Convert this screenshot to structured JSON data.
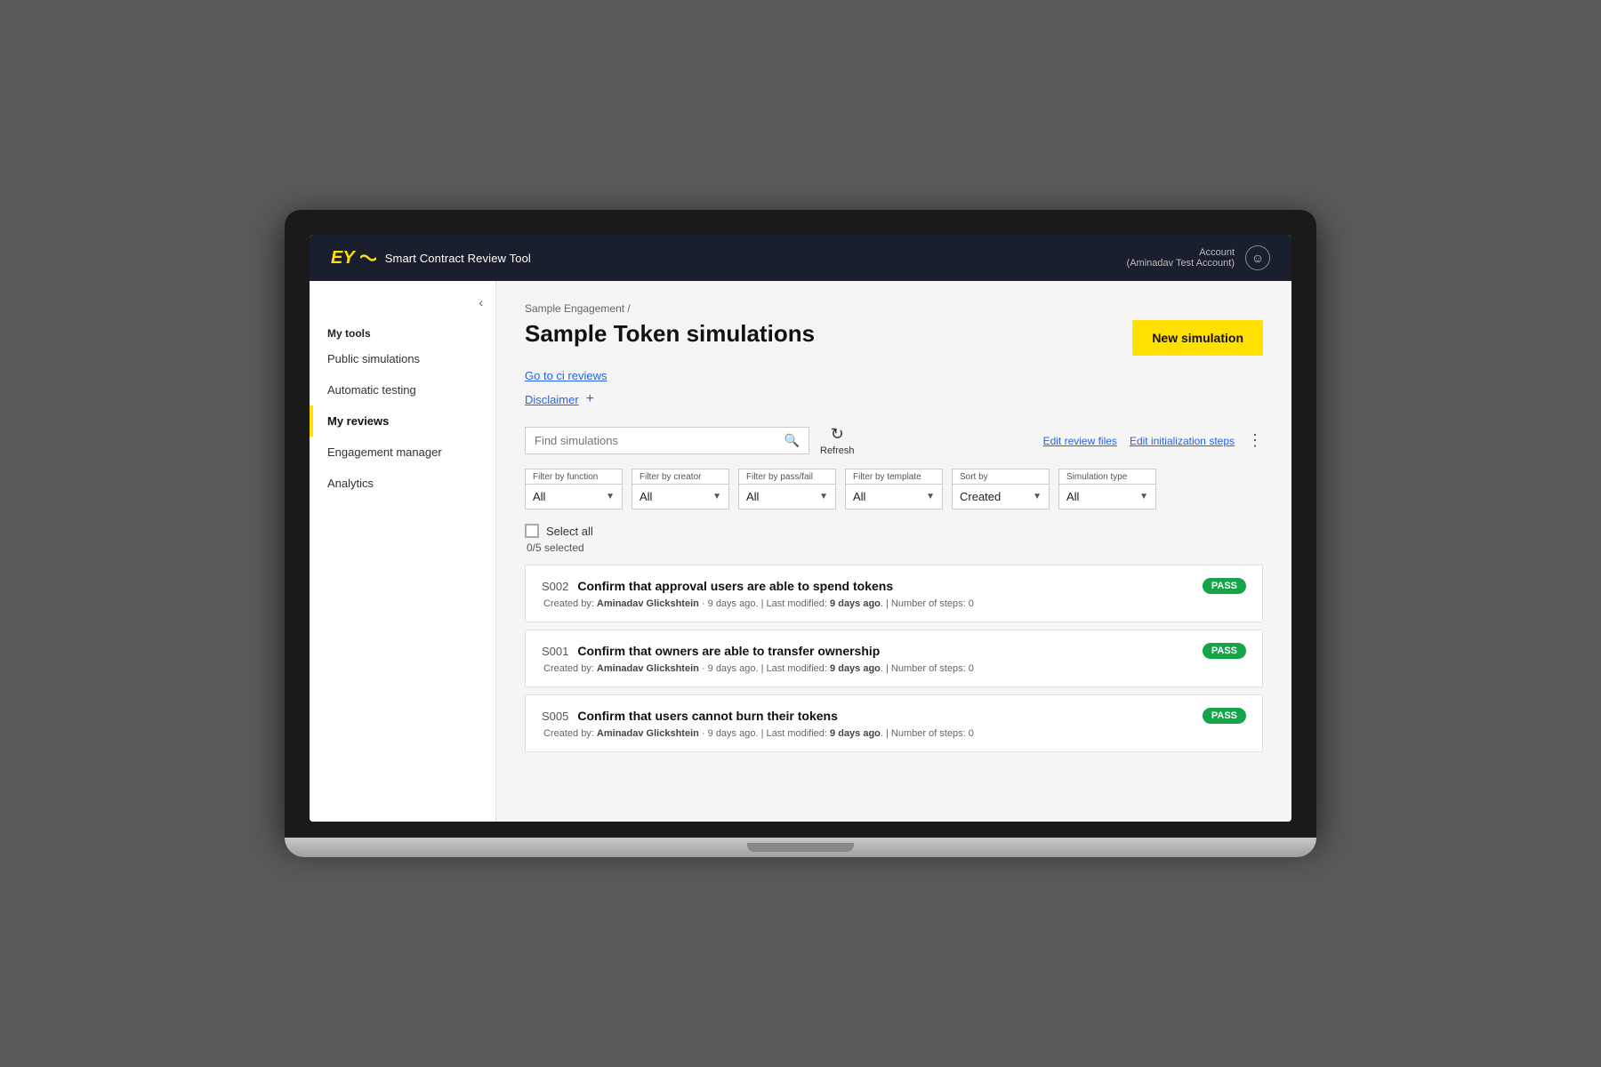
{
  "app": {
    "title": "Smart Contract Review Tool",
    "logo": "EY"
  },
  "account": {
    "label": "Account",
    "name": "(Aminadav Test Account)"
  },
  "sidebar": {
    "toggle_icon": "‹",
    "section_label": "My tools",
    "items": [
      {
        "id": "public-simulations",
        "label": "Public simulations",
        "active": false
      },
      {
        "id": "automatic-testing",
        "label": "Automatic testing",
        "active": false
      },
      {
        "id": "my-reviews",
        "label": "My reviews",
        "active": true
      },
      {
        "id": "engagement-manager",
        "label": "Engagement manager",
        "active": false
      },
      {
        "id": "analytics",
        "label": "Analytics",
        "active": false
      }
    ]
  },
  "breadcrumb": "Sample Engagement /",
  "page": {
    "title": "Sample Token simulations",
    "ci_link": "Go to ci reviews",
    "disclaimer_link": "Disclaimer",
    "new_simulation_btn": "New simulation"
  },
  "toolbar": {
    "search_placeholder": "Find simulations",
    "refresh_label": "Refresh",
    "edit_review_files": "Edit review files",
    "edit_init_steps": "Edit initialization steps"
  },
  "filters": [
    {
      "id": "filter-function",
      "label": "Filter by function",
      "value": "All"
    },
    {
      "id": "filter-creator",
      "label": "Filter by creator",
      "value": "All"
    },
    {
      "id": "filter-pass-fail",
      "label": "Filter by pass/fail",
      "value": "All"
    },
    {
      "id": "filter-template",
      "label": "Filter by template",
      "value": "All"
    },
    {
      "id": "sort-by",
      "label": "Sort by",
      "value": "Created"
    },
    {
      "id": "sim-type",
      "label": "Simulation type",
      "value": "All"
    }
  ],
  "select_all": {
    "label": "Select all",
    "count": "0/5 selected"
  },
  "simulations": [
    {
      "id": "S002",
      "title": "Confirm that approval users are able to spend tokens",
      "status": "PASS",
      "created_by": "Aminadav Glickshtein",
      "created_ago": "9 days ago",
      "modified_ago": "9 days ago",
      "steps": "0"
    },
    {
      "id": "S001",
      "title": "Confirm that owners are able to transfer ownership",
      "status": "PASS",
      "created_by": "Aminadav Glickshtein",
      "created_ago": "9 days ago",
      "modified_ago": "9 days ago",
      "steps": "0"
    },
    {
      "id": "S005",
      "title": "Confirm that users cannot burn their tokens",
      "status": "PASS",
      "created_by": "Aminadav Glickshtein",
      "created_ago": "9 days ago",
      "modified_ago": "9 days ago",
      "steps": "0"
    }
  ]
}
